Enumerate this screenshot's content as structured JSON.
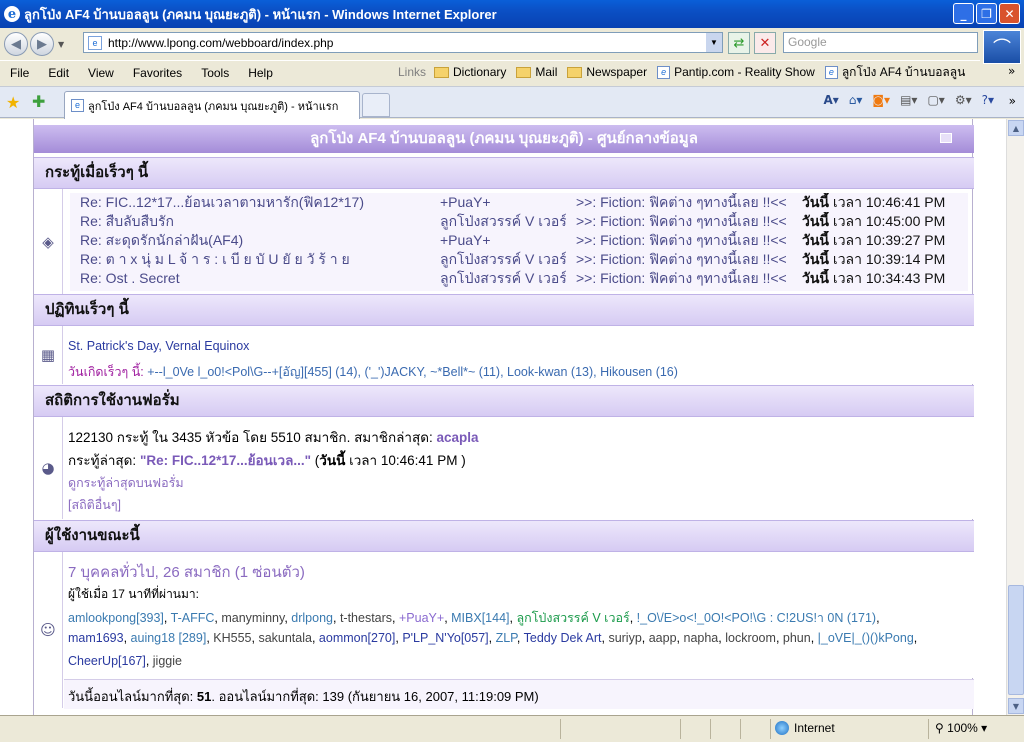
{
  "window": {
    "title": "ลูกโป่ง AF4 บ้านบอลลูน (ภคมน บุณยะภูติ) - หน้าแรก - Windows Internet Explorer",
    "ie_glyph": "e",
    "min_glyph": "_",
    "max_glyph": "❐",
    "close_glyph": "✕"
  },
  "toolbar": {
    "back_glyph": "◀",
    "forward_glyph": "▶",
    "address": "http://www.lpong.com/webboard/index.php",
    "search_placeholder": "Google",
    "refresh_glyph": "⇄",
    "stop_glyph": "✕"
  },
  "menu": [
    "File",
    "Edit",
    "View",
    "Favorites",
    "Tools",
    "Help"
  ],
  "links_bar": {
    "label": "Links",
    "items": [
      {
        "text": "Dictionary",
        "icon": "folder-icon"
      },
      {
        "text": "Mail",
        "icon": "folder-icon"
      },
      {
        "text": "Newspaper",
        "icon": "folder-icon"
      },
      {
        "text": "Pantip.com - Reality Show",
        "icon": "ie-page-icon"
      },
      {
        "text": "ลูกโป่ง AF4 บ้านบอลลูน",
        "icon": "ie-page-icon"
      }
    ],
    "more_glyph": "»"
  },
  "tab": {
    "title": "ลูกโป่ง AF4 บ้านบอลลูน (ภคมน บุณยะภูติ) - หน้าแรก"
  },
  "cmd_icons": [
    "home-icon",
    "rss-icon",
    "print-icon",
    "page-icon",
    "tools-icon",
    "help-icon"
  ],
  "board": {
    "header": "ลูกโป่ง AF4 บ้านบอลลูน (ภคมน บุณยะภูติ) - ศูนย์กลางข้อมูล",
    "recent_title": "กระทู้เมื่อเร็วๆ นี้",
    "recent_posts": [
      {
        "subject": "Re: FIC..12*17...ย้อนเวลาตามหารัก(ฟิค12*17)",
        "author": "+PuaY+",
        "board": ">>: Fiction: ฟิคต่าง ๆทางนี้เลย !!<<",
        "time_label": "วันนี้",
        "time": "เวลา 10:46:41 PM"
      },
      {
        "subject": "Re: สืบลับสืบรัก",
        "author": "ลูกโป่งสวรรค์ V เวอร์",
        "board": ">>: Fiction: ฟิคต่าง ๆทางนี้เลย !!<<",
        "time_label": "วันนี้",
        "time": "เวลา 10:45:00 PM"
      },
      {
        "subject": "Re: สะดุดรักนักล่าฝัน(AF4)",
        "author": "+PuaY+",
        "board": ">>: Fiction: ฟิคต่าง ๆทางนี้เลย !!<<",
        "time_label": "วันนี้",
        "time": "เวลา 10:39:27 PM"
      },
      {
        "subject": "Re: ต า x นุ่ ม L จ้ า ร : เ บี ย บั U ยั ย วั ร้ า ย",
        "author": "ลูกโป่งสวรรค์ V เวอร์",
        "board": ">>: Fiction: ฟิคต่าง ๆทางนี้เลย !!<<",
        "time_label": "วันนี้",
        "time": "เวลา 10:39:14 PM"
      },
      {
        "subject": "Re: Ost . Secret",
        "author": "ลูกโป่งสวรรค์ V เวอร์",
        "board": ">>: Fiction: ฟิคต่าง ๆทางนี้เลย !!<<",
        "time_label": "วันนี้",
        "time": "เวลา 10:34:43 PM"
      }
    ],
    "calendar_title": "ปฏิทินเร็วๆ นี้",
    "calendar_events": "St. Patrick's Day, Vernal Equinox",
    "birthdays_label": "วันเกิดเร็วๆ นี้:",
    "birthdays": "+--l_0Ve l_o0!<Pol\\G--+[อัญ][455] (14), ('_')JACKY, ~*Bell*~ (11), Look-kwan (13), Hikousen (16)",
    "stats_title": "สถิติการใช้งานฟอรั่ม",
    "stats_line": "122130 กระทู้ ใน 3435 หัวข้อ โดย 5510 สมาชิก. สมาชิกล่าสุด:",
    "latest_member": "acapla",
    "latest_post_label": "กระทู้ล่าสุด:",
    "latest_post": "\"Re: FIC..12*17...ย้อนเวล...\"",
    "latest_post_time_open": "(",
    "latest_post_time_day": "วันนี้",
    "latest_post_time": "เวลา 10:46:41 PM )",
    "view_latest_link": "ดูกระทู้ล่าสุดบนฟอรั่ม",
    "more_stats_link": "[สถิติอื่นๆ]",
    "online_title": "ผู้ใช้งานขณะนี้",
    "online_count": "7 บุคคลทั่วไป, 26 สมาชิก (1 ซ่อนตัว)",
    "online_window": "ผู้ใช้เมื่อ 17 นาทีที่ผ่านมา:",
    "users_line1": [
      {
        "n": "amlookpong[393]",
        "c": "#3a7ab0"
      },
      {
        "n": "T-AFFC",
        "c": "#3a7ab0"
      },
      {
        "n": "manyminny",
        "c": "#444444"
      },
      {
        "n": "drlpong",
        "c": "#3a7ab0"
      },
      {
        "n": "t-thestars",
        "c": "#444444"
      },
      {
        "n": "+PuaY+",
        "c": "#8a6ad0"
      },
      {
        "n": "MIBX[144]",
        "c": "#3a7ab0"
      },
      {
        "n": "ลูกโป่งสวรรค์ V เวอร์",
        "c": "#1a9a4a"
      },
      {
        "n": "!_O\\/E>o<!_0O!<PO!\\G : C!2US!า 0N (171)",
        "c": "#3a7ab0"
      }
    ],
    "users_line2": [
      {
        "n": "mam1693",
        "c": "#2a3aa0"
      },
      {
        "n": "auing18 [289]",
        "c": "#3a7ab0"
      },
      {
        "n": "KH555",
        "c": "#444444"
      },
      {
        "n": "sakuntala",
        "c": "#444444"
      },
      {
        "n": "aommon[270]",
        "c": "#2a3aa0"
      },
      {
        "n": "P'LP_N'Yo[057]",
        "c": "#2a3aa0"
      },
      {
        "n": "ZLP",
        "c": "#3a7ab0"
      },
      {
        "n": "Teddy Dek Art",
        "c": "#2a3aa0"
      },
      {
        "n": "suriyp",
        "c": "#444444"
      },
      {
        "n": "aapp",
        "c": "#444444"
      },
      {
        "n": "napha",
        "c": "#444444"
      },
      {
        "n": "lockroom",
        "c": "#444444"
      },
      {
        "n": "phun",
        "c": "#444444"
      },
      {
        "n": "|_oVE|_()()kPong",
        "c": "#3a7ab0"
      }
    ],
    "users_line3": [
      {
        "n": "CheerUp[167]",
        "c": "#2a3aa0"
      },
      {
        "n": "jiggie",
        "c": "#444444"
      }
    ],
    "most_online": "วันนี้ออนไลน์มากที่สุด:",
    "most_online_today": "51",
    "most_online_ever": ". ออนไลน์มากที่สุด: 139 (กันยายน 16, 2007, 11:19:09 PM)"
  },
  "statusbar": {
    "zone": "Internet",
    "zoom": "100%"
  }
}
